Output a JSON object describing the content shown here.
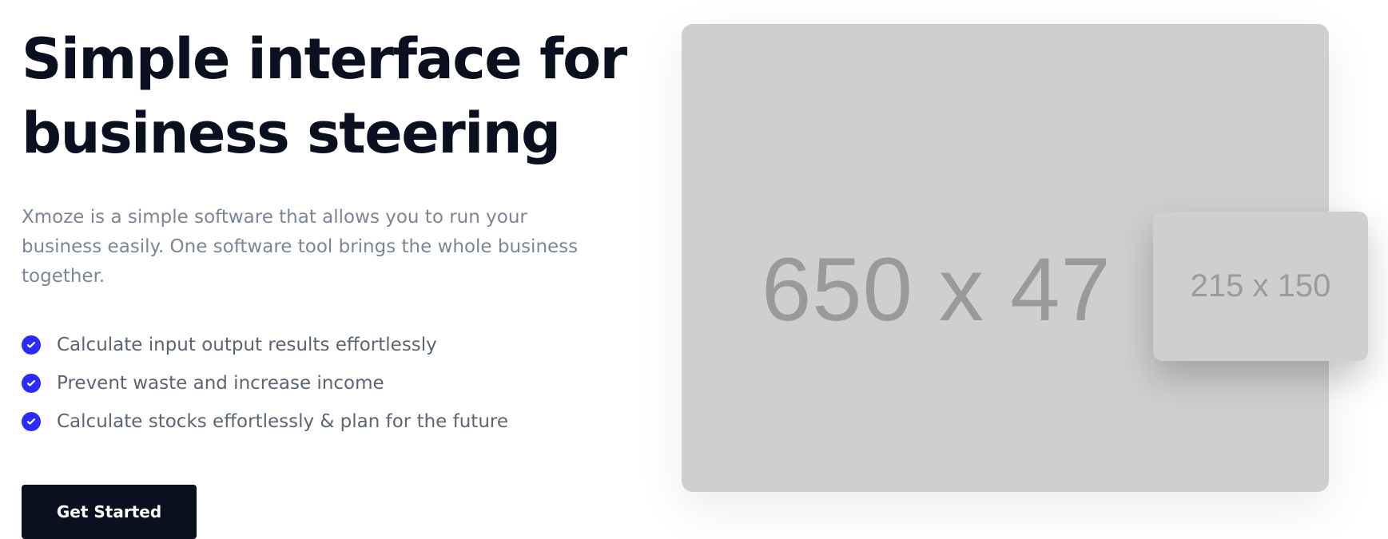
{
  "hero": {
    "title": "Simple interface for\nbusiness steering",
    "description": "Xmoze is a simple software that allows you to run your business easily. One software tool brings the whole business together.",
    "features": [
      "Calculate input output results effortlessly",
      "Prevent waste and increase income",
      "Calculate stocks effortlessly & plan for the future"
    ],
    "cta_label": "Get Started"
  },
  "media": {
    "main_placeholder": "650 x 47",
    "small_placeholder": "215 x 150"
  },
  "colors": {
    "title": "#0b1020",
    "text": "#7b8794",
    "accent": "#2b2bff",
    "button_bg": "#0b1020",
    "placeholder_bg": "#cfcfcf"
  },
  "icons": {
    "feature_check": "check-circle-icon"
  }
}
